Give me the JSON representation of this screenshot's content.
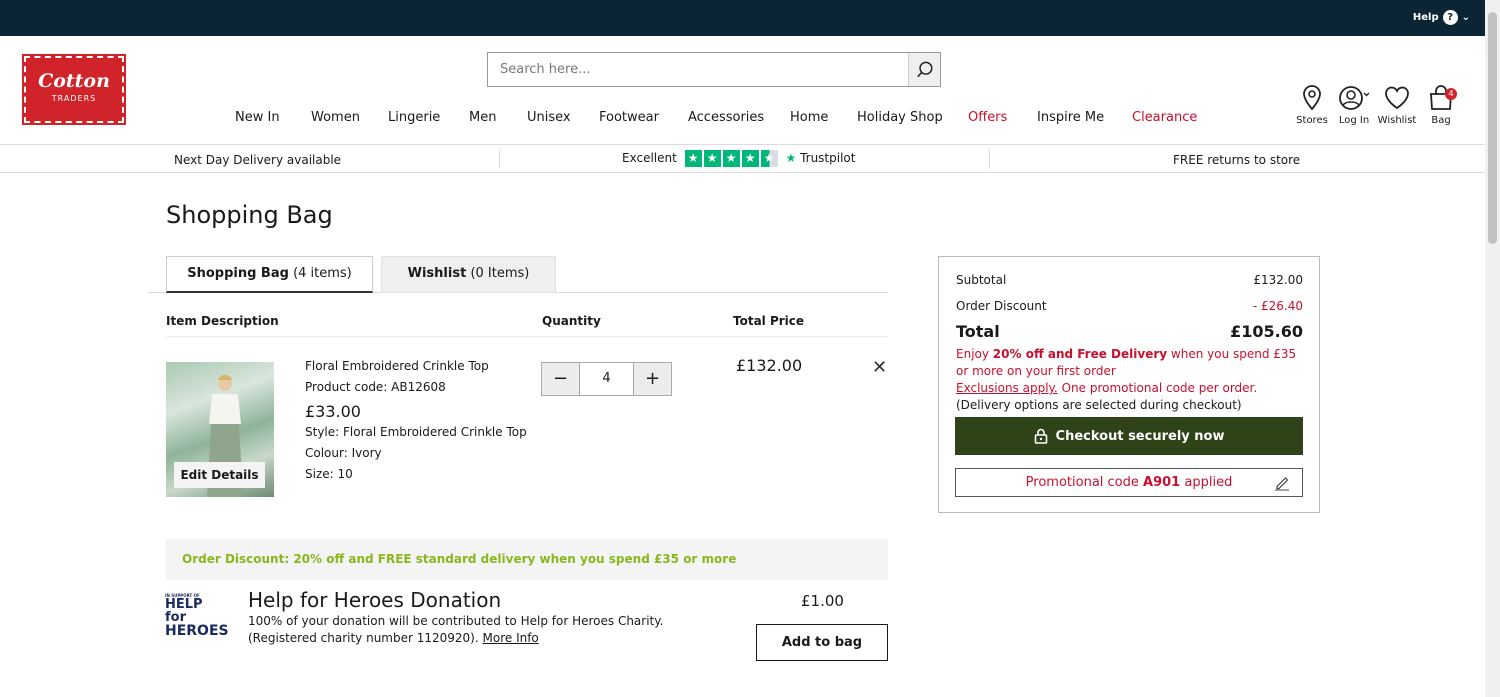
{
  "topbar": {
    "help_label": "Help"
  },
  "logo": {
    "line1": "Cotton",
    "line2": "TRADERS"
  },
  "search": {
    "placeholder": "Search here..."
  },
  "nav": {
    "items": [
      {
        "label": "New In"
      },
      {
        "label": "Women"
      },
      {
        "label": "Lingerie"
      },
      {
        "label": "Men"
      },
      {
        "label": "Unisex"
      },
      {
        "label": "Footwear"
      },
      {
        "label": "Accessories"
      },
      {
        "label": "Home"
      },
      {
        "label": "Holiday Shop"
      },
      {
        "label": "Offers",
        "color": "#c8102e"
      },
      {
        "label": "Inspire Me"
      },
      {
        "label": "Clearance",
        "color": "#c8102e"
      }
    ]
  },
  "header_icons": {
    "stores": "Stores",
    "login": "Log In",
    "wishlist": "Wishlist",
    "bag": "Bag",
    "bag_count": "4"
  },
  "strip": {
    "left": "Next Day Delivery available",
    "rating_word": "Excellent",
    "trustpilot": "Trustpilot",
    "right": "FREE returns to store"
  },
  "page_title": "Shopping Bag",
  "tabs": {
    "bag_label": "Shopping Bag",
    "bag_count": "(4 items)",
    "wishlist_label": "Wishlist",
    "wishlist_count": "(0 Items)"
  },
  "columns": {
    "item": "Item Description",
    "quantity": "Quantity",
    "total": "Total Price"
  },
  "item": {
    "name": "Floral Embroidered Crinkle Top",
    "product_code": "Product code: AB12608",
    "unit_price": "£33.00",
    "style": "Style: Floral Embroidered Crinkle Top",
    "colour": "Colour: Ivory",
    "size": "Size: 10",
    "edit_label": "Edit Details",
    "quantity": "4",
    "line_total": "£132.00"
  },
  "discount_banner": "Order Discount: 20% off and FREE standard delivery when you spend £35 or more",
  "donation": {
    "logo_small": "IN SUPPORT OF",
    "logo_line1": "HELP for",
    "logo_line2": "HEROES",
    "title": "Help for Heroes Donation",
    "line1": "100% of your donation will be contributed to Help for Heroes Charity.",
    "line2": "(Registered charity number 1120920).",
    "more_info": "More Info",
    "price": "£1.00",
    "add_label": "Add to bag"
  },
  "summary": {
    "subtotal_label": "Subtotal",
    "subtotal_value": "£132.00",
    "discount_label": "Order Discount",
    "discount_value": "- £26.40",
    "total_label": "Total",
    "total_value": "£105.60",
    "promo_prefix": "Enjoy",
    "promo_bold": "20% off and Free Delivery",
    "promo_suffix": "when you spend £35 or more on your first order",
    "exclusions": "Exclusions apply.",
    "one_code": "One promotional code per order.",
    "delivery_note": "(Delivery options are selected during checkout)",
    "checkout_label": "Checkout securely now",
    "promo_applied_prefix": "Promotional code",
    "promo_code": "A901",
    "promo_applied_suffix": "applied"
  },
  "colors": {
    "topbar": "#0b2535",
    "brand_red": "#d0232a",
    "checkout_green": "#2f4318",
    "discount_green": "#8ab61e",
    "trustpilot_green": "#00b67a"
  }
}
